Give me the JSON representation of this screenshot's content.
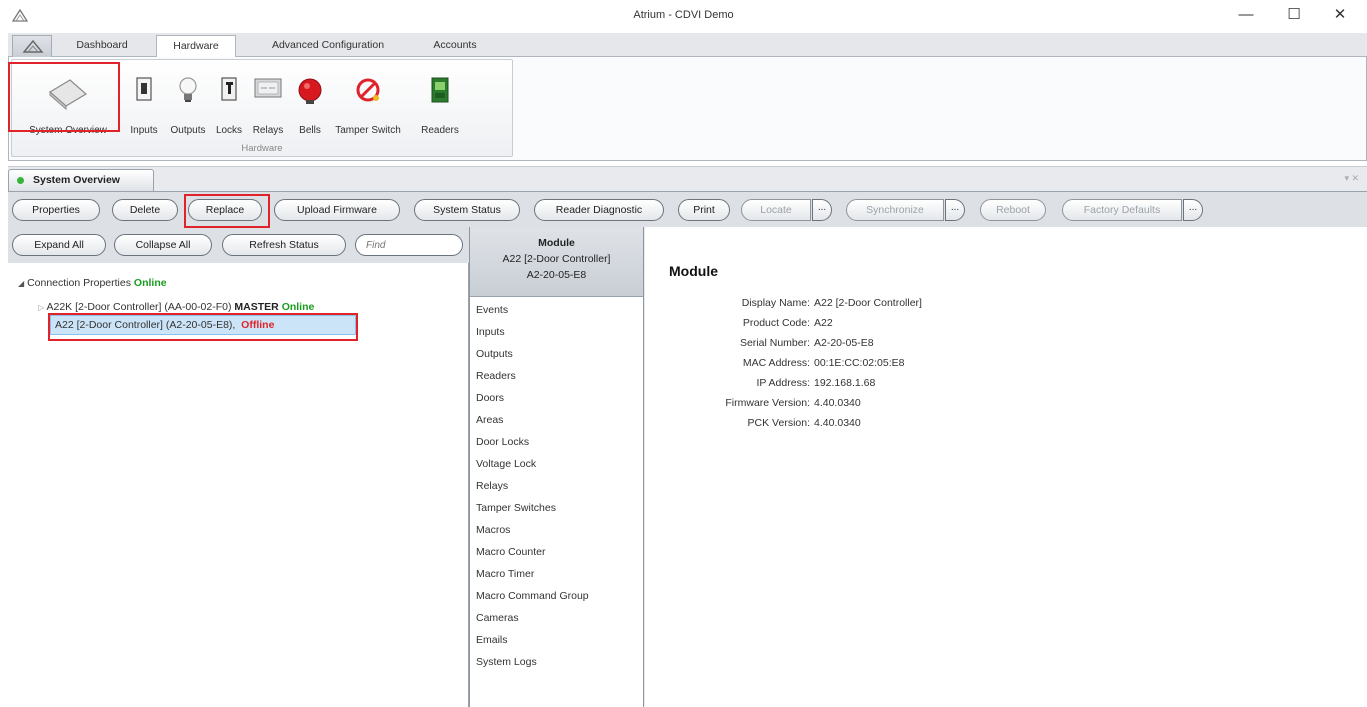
{
  "window": {
    "title": "Atrium - CDVI Demo",
    "minimize": "—",
    "maximize": "☐",
    "close": "✕"
  },
  "ribbon_tabs": [
    {
      "label": "Dashboard"
    },
    {
      "label": "Hardware"
    },
    {
      "label": "Advanced Configuration"
    },
    {
      "label": "Accounts"
    }
  ],
  "ribbon": {
    "group_label": "Hardware",
    "buttons": [
      {
        "label": "System Overview",
        "icon": "system-overview-icon"
      },
      {
        "label": "Inputs",
        "icon": "switch-icon"
      },
      {
        "label": "Outputs",
        "icon": "lightbulb-icon"
      },
      {
        "label": "Locks",
        "icon": "lock-icon"
      },
      {
        "label": "Relays",
        "icon": "relay-icon"
      },
      {
        "label": "Bells",
        "icon": "bell-icon"
      },
      {
        "label": "Tamper Switch",
        "icon": "no-entry-icon"
      },
      {
        "label": "Readers",
        "icon": "reader-icon"
      }
    ]
  },
  "doc_tab": {
    "label": "System Overview"
  },
  "toolbar": {
    "properties": "Properties",
    "delete": "Delete",
    "replace": "Replace",
    "upload_firmware": "Upload Firmware",
    "system_status": "System Status",
    "reader_diagnostic": "Reader Diagnostic",
    "print": "Print",
    "locate": "Locate",
    "synchronize": "Synchronize",
    "reboot": "Reboot",
    "factory_defaults": "Factory Defaults",
    "more": "..."
  },
  "left_toolbar": {
    "expand_all": "Expand All",
    "collapse_all": "Collapse All",
    "refresh_status": "Refresh Status",
    "find_placeholder": "Find"
  },
  "tree": {
    "root_label": "Connection Properties",
    "root_status": "Online",
    "node1_label": "A22K [2-Door Controller] (AA-00-02-F0)",
    "node1_role": "MASTER",
    "node1_status": "Online",
    "node2_label": "A22 [2-Door Controller] (A2-20-05-E8),",
    "node2_status": "Offline"
  },
  "module_panel": {
    "header": "Module",
    "name": "A22 [2-Door Controller]",
    "serial": "A2-20-05-E8",
    "items": [
      "Events",
      "Inputs",
      "Outputs",
      "Readers",
      "Doors",
      "Areas",
      "Door Locks",
      "Voltage Lock",
      "Relays",
      "Tamper Switches",
      "Macros",
      "Macro Counter",
      "Macro Timer",
      "Macro Command Group",
      "Cameras",
      "Emails",
      "System Logs"
    ]
  },
  "details": {
    "title": "Module",
    "rows": [
      {
        "key": "Display Name:",
        "value": "A22 [2-Door Controller]"
      },
      {
        "key": "Product Code:",
        "value": "A22"
      },
      {
        "key": "Serial Number:",
        "value": "A2-20-05-E8"
      },
      {
        "key": "MAC Address:",
        "value": "00:1E:CC:02:05:E8"
      },
      {
        "key": "IP Address:",
        "value": "192.168.1.68"
      },
      {
        "key": "Firmware Version:",
        "value": "4.40.0340"
      },
      {
        "key": "PCK Version:",
        "value": "4.40.0340"
      }
    ]
  },
  "colors": {
    "online": "#1a9c1f",
    "offline": "#e0232b",
    "highlight_box": "#e0232b",
    "selection": "#cce4f7"
  }
}
